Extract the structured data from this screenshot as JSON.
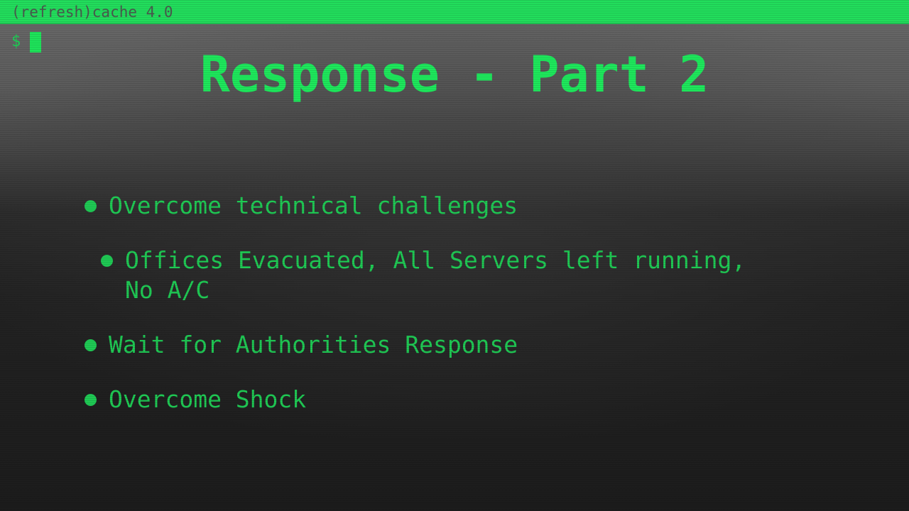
{
  "header": {
    "title": "(refresh)cache 4.0"
  },
  "terminal": {
    "prompt": "$"
  },
  "slide": {
    "title": "Response - Part 2",
    "bullets": [
      {
        "text": "Overcome technical challenges",
        "level": 1
      },
      {
        "text": "Offices Evacuated, All Servers left running, No A/C",
        "level": 2
      },
      {
        "text": "Wait for Authorities Response",
        "level": 1
      },
      {
        "text": "Overcome Shock",
        "level": 1
      }
    ]
  },
  "colors": {
    "accent": "#22dd5c",
    "text_green": "#1fc954",
    "title_green": "#1ee85c"
  }
}
